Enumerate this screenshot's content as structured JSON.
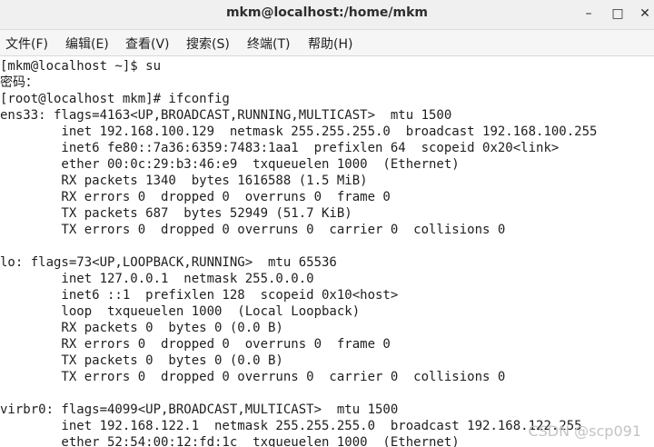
{
  "window": {
    "title": "mkm@localhost:/home/mkm",
    "minimize_glyph": "–",
    "maximize_glyph": "□",
    "close_glyph": "✕"
  },
  "menu": {
    "items": [
      "文件(F)",
      "编辑(E)",
      "查看(V)",
      "搜索(S)",
      "终端(T)",
      "帮助(H)"
    ]
  },
  "terminal": {
    "lines": [
      "[mkm@localhost ~]$ su",
      "密码：",
      "[root@localhost mkm]# ifconfig",
      "ens33: flags=4163<UP,BROADCAST,RUNNING,MULTICAST>  mtu 1500",
      "        inet 192.168.100.129  netmask 255.255.255.0  broadcast 192.168.100.255",
      "        inet6 fe80::7a36:6359:7483:1aa1  prefixlen 64  scopeid 0x20<link>",
      "        ether 00:0c:29:b3:46:e9  txqueuelen 1000  (Ethernet)",
      "        RX packets 1340  bytes 1616588 (1.5 MiB)",
      "        RX errors 0  dropped 0  overruns 0  frame 0",
      "        TX packets 687  bytes 52949 (51.7 KiB)",
      "        TX errors 0  dropped 0 overruns 0  carrier 0  collisions 0",
      "",
      "lo: flags=73<UP,LOOPBACK,RUNNING>  mtu 65536",
      "        inet 127.0.0.1  netmask 255.0.0.0",
      "        inet6 ::1  prefixlen 128  scopeid 0x10<host>",
      "        loop  txqueuelen 1000  (Local Loopback)",
      "        RX packets 0  bytes 0 (0.0 B)",
      "        RX errors 0  dropped 0  overruns 0  frame 0",
      "        TX packets 0  bytes 0 (0.0 B)",
      "        TX errors 0  dropped 0 overruns 0  carrier 0  collisions 0",
      "",
      "virbr0: flags=4099<UP,BROADCAST,MULTICAST>  mtu 1500",
      "        inet 192.168.122.1  netmask 255.255.255.0  broadcast 192.168.122.255",
      "        ether 52:54:00:12:fd:1c  txqueuelen 1000  (Ethernet)"
    ]
  },
  "watermark": "CSDN @scp091"
}
